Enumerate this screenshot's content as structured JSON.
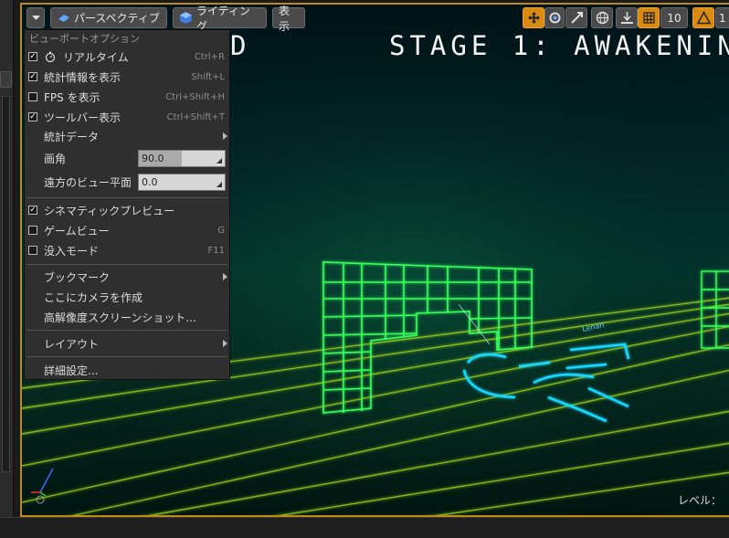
{
  "toolbar": {
    "dropdown_icon": "chevron-down-icon",
    "perspective_label": "パースペクティブ",
    "lighting_label": "ライティング",
    "show_label": "表示",
    "grid_value": "10",
    "rotation_value": "1"
  },
  "viewport": {
    "stage_title": "STAGE 1: AWAKENIN",
    "left_text": "D",
    "level_label": "レベル："
  },
  "menu": {
    "header": "ビューポートオプション",
    "realtime": {
      "label": "リアルタイム",
      "shortcut": "Ctrl+R",
      "checked": true
    },
    "stats": {
      "label": "統計情報を表示",
      "shortcut": "Shift+L",
      "checked": true
    },
    "fps": {
      "label": "FPS を表示",
      "shortcut": "Ctrl+Shift+H",
      "checked": false
    },
    "toolbar_show": {
      "label": "ツールバー表示",
      "shortcut": "Ctrl+Shift+T",
      "checked": true
    },
    "stat_data": {
      "label": "統計データ"
    },
    "fov": {
      "label": "画角",
      "value": "90.0",
      "fill": 0.5
    },
    "far_plane": {
      "label": "遠方のビュー平面",
      "value": "0.0",
      "fill": 0.0
    },
    "cinematic": {
      "label": "シネマティックプレビュー",
      "checked": true
    },
    "game_view": {
      "label": "ゲームビュー",
      "shortcut": "G",
      "checked": false
    },
    "immersive": {
      "label": "没入モード",
      "shortcut": "F11",
      "checked": false
    },
    "bookmark": {
      "label": "ブックマーク"
    },
    "create_camera": {
      "label": "ここにカメラを作成"
    },
    "hires_shot": {
      "label": "高解像度スクリーンショット..."
    },
    "layout": {
      "label": "レイアウト"
    },
    "advanced": {
      "label": "詳細設定..."
    }
  }
}
